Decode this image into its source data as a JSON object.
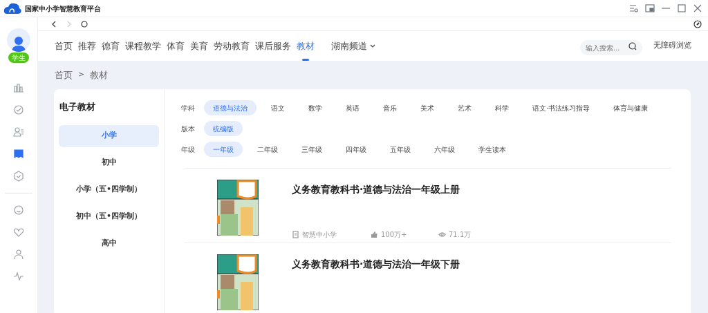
{
  "window": {
    "title": "国家中小学智慧教育平台"
  },
  "user": {
    "badge": "学生"
  },
  "sidebar": {
    "top_items": [
      {
        "selected": false
      },
      {
        "selected": false
      },
      {
        "selected": false
      },
      {
        "selected": true
      },
      {
        "selected": false
      }
    ],
    "bottom_items": [
      {
        "selected": false
      },
      {
        "selected": false
      },
      {
        "selected": false
      },
      {
        "selected": false
      }
    ]
  },
  "nav": {
    "items": [
      {
        "label": "首页",
        "selected": false
      },
      {
        "label": "推荐",
        "selected": false
      },
      {
        "label": "德育",
        "selected": false
      },
      {
        "label": "课程教学",
        "selected": false
      },
      {
        "label": "体育",
        "selected": false
      },
      {
        "label": "美育",
        "selected": false
      },
      {
        "label": "劳动教育",
        "selected": false
      },
      {
        "label": "课后服务",
        "selected": false
      },
      {
        "label": "教材",
        "selected": true
      }
    ],
    "channel": "湖南频道",
    "search": {
      "placeholder": "输入搜索..."
    },
    "accessibility": "无障碍浏览"
  },
  "breadcrumb": {
    "items": [
      "首页",
      "教材"
    ],
    "separator": ">"
  },
  "panel": {
    "title": "电子教材",
    "levels": [
      {
        "label": "小学",
        "selected": true
      },
      {
        "label": "初中",
        "selected": false
      },
      {
        "label": "小学（五•四学制）",
        "selected": false
      },
      {
        "label": "初中（五•四学制）",
        "selected": false
      },
      {
        "label": "高中",
        "selected": false
      }
    ]
  },
  "filters": [
    {
      "label": "学科",
      "options": [
        {
          "label": "道德与法治",
          "selected": true
        },
        {
          "label": "语文",
          "selected": false
        },
        {
          "label": "数学",
          "selected": false
        },
        {
          "label": "英语",
          "selected": false
        },
        {
          "label": "音乐",
          "selected": false
        },
        {
          "label": "美术",
          "selected": false
        },
        {
          "label": "艺术",
          "selected": false
        },
        {
          "label": "科学",
          "selected": false
        },
        {
          "label": "语文·书法练习指导",
          "selected": false
        },
        {
          "label": "体育与健康",
          "selected": false
        }
      ]
    },
    {
      "label": "版本",
      "options": [
        {
          "label": "统编版",
          "selected": true
        }
      ]
    },
    {
      "label": "年级",
      "options": [
        {
          "label": "一年级",
          "selected": true
        },
        {
          "label": "二年级",
          "selected": false
        },
        {
          "label": "三年级",
          "selected": false
        },
        {
          "label": "四年级",
          "selected": false
        },
        {
          "label": "五年级",
          "selected": false
        },
        {
          "label": "六年级",
          "selected": false
        },
        {
          "label": "学生读本",
          "selected": false
        }
      ]
    }
  ],
  "books": [
    {
      "title": "义务教育教科书·道德与法治一年级上册",
      "publisher": "智慧中小学",
      "likes": "100万+",
      "views": "71.1万"
    },
    {
      "title": "义务教育教科书·道德与法治一年级下册"
    }
  ]
}
